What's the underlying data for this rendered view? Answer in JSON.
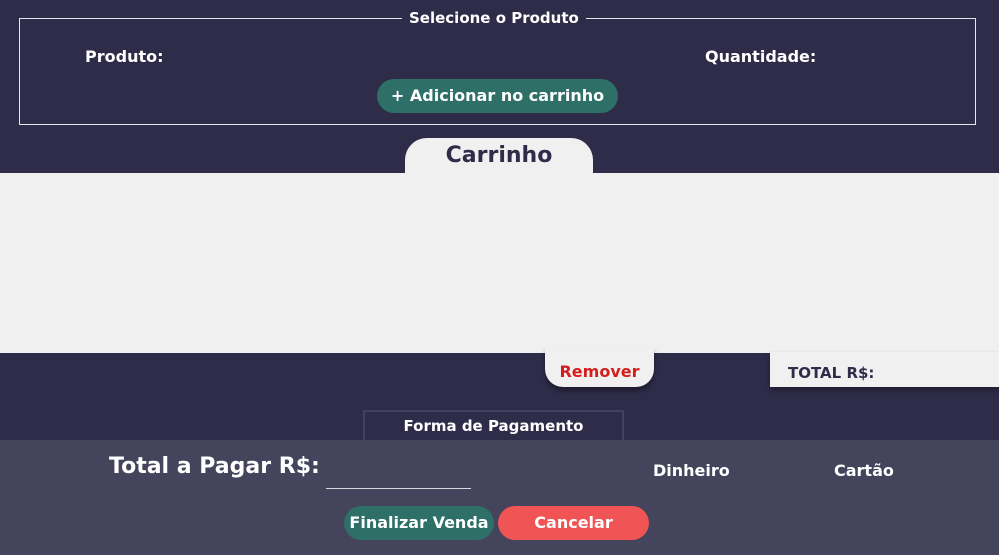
{
  "product_section": {
    "legend": "Selecione o Produto",
    "product_label": "Produto:",
    "quantity_label": "Quantidade:",
    "add_button": "+ Adicionar no carrinho"
  },
  "cart": {
    "tab_title": "Carrinho",
    "remove_button": "Remover",
    "total_label": "TOTAL R$:"
  },
  "payment": {
    "title": "Forma de Pagamento",
    "total_label": "Total a Pagar R$:",
    "total_value": "",
    "options": [
      "Dinheiro",
      "Cartão"
    ],
    "finalize_button": "Finalizar Venda",
    "cancel_button": "Cancelar"
  },
  "colors": {
    "background": "#2e2c48",
    "panel": "#45445d",
    "light": "#f0f0f0",
    "primary_button": "#2e6f68",
    "danger_button": "#f05454",
    "danger_text": "#d41e1e"
  }
}
